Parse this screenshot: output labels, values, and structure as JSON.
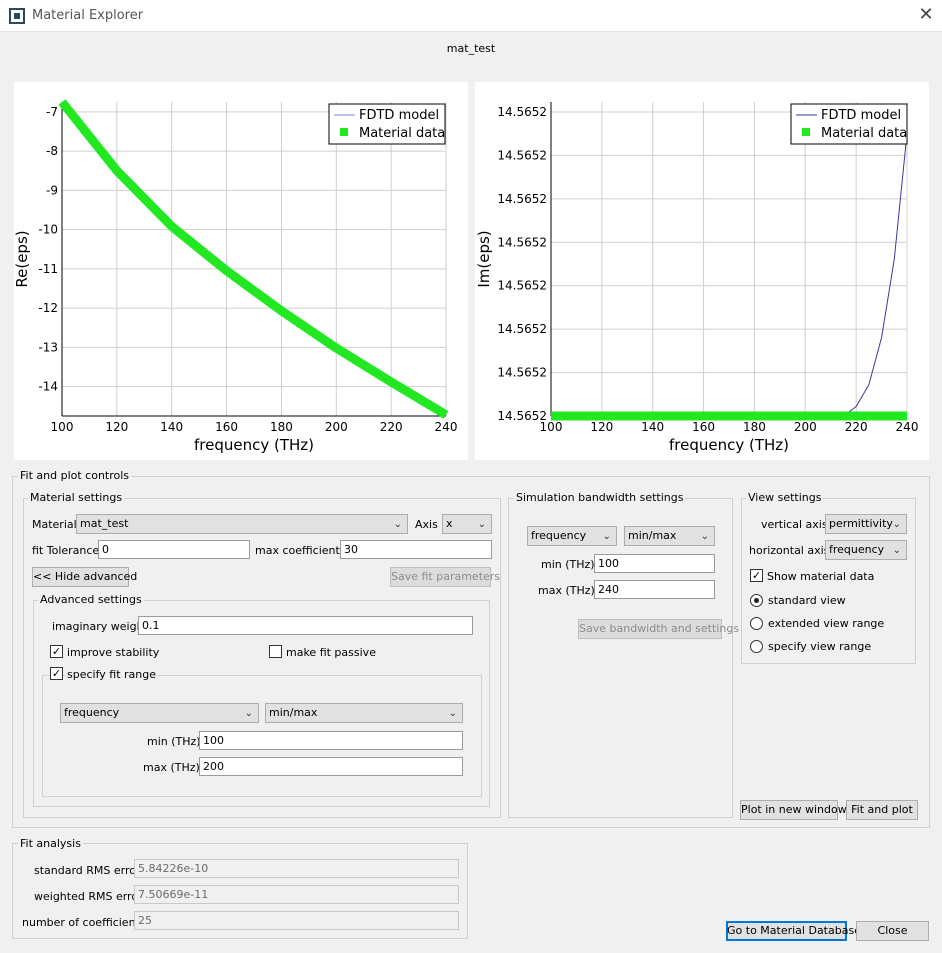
{
  "window": {
    "title": "Material Explorer",
    "close_glyph": "✕",
    "material_title": "mat_test"
  },
  "plots": {
    "legend": {
      "model": "FDTD model",
      "data": "Material data"
    },
    "left": {
      "ylabel": "Re(eps)",
      "xlabel": "frequency (THz)",
      "xticks": [
        "100",
        "120",
        "140",
        "160",
        "180",
        "200",
        "220",
        "240"
      ],
      "yticks": [
        "-7",
        "-8",
        "-9",
        "-10",
        "-11",
        "-12",
        "-13",
        "-14"
      ]
    },
    "right": {
      "ylabel": "Im(eps)",
      "xlabel": "frequency (THz)",
      "xticks": [
        "100",
        "120",
        "140",
        "160",
        "180",
        "200",
        "220",
        "240"
      ],
      "yticks": [
        "14.5652",
        "14.5652",
        "14.5652",
        "14.5652",
        "14.5652",
        "14.5652",
        "14.5652",
        "14.5652"
      ]
    }
  },
  "chart_data": [
    {
      "type": "line",
      "xlabel": "frequency (THz)",
      "ylabel": "Re(eps)",
      "xlim": [
        100,
        240
      ],
      "ylim": [
        -14.75,
        -6.75
      ],
      "series": [
        {
          "name": "FDTD model",
          "color": "#7b86d6",
          "x": [
            100,
            120,
            140,
            160,
            180,
            200,
            220,
            240
          ],
          "y": [
            -6.75,
            -8.5,
            -9.92,
            -11.05,
            -12.07,
            -13.02,
            -13.88,
            -14.72
          ]
        },
        {
          "name": "Material data",
          "color": "#22e822",
          "x": [
            100,
            120,
            140,
            160,
            180,
            200,
            220,
            240
          ],
          "y": [
            -6.75,
            -8.5,
            -9.92,
            -11.05,
            -12.07,
            -13.02,
            -13.88,
            -14.72
          ]
        }
      ]
    },
    {
      "type": "line",
      "xlabel": "frequency (THz)",
      "ylabel": "Im(eps)",
      "xlim": [
        100,
        240
      ],
      "ylim": [
        0,
        1
      ],
      "series": [
        {
          "name": "FDTD model",
          "color": "#3a3aa0",
          "x": [
            100,
            200,
            215,
            220,
            225,
            230,
            235,
            240
          ],
          "y": [
            0,
            0,
            0,
            0.03,
            0.1,
            0.25,
            0.5,
            0.9
          ]
        },
        {
          "name": "Material data",
          "color": "#22e822",
          "x": [
            100,
            120,
            140,
            160,
            180,
            200,
            220,
            240
          ],
          "y": [
            0,
            0,
            0,
            0,
            0,
            0,
            0,
            0
          ]
        }
      ]
    }
  ],
  "fit_controls": {
    "title": "Fit and plot controls",
    "material_settings": {
      "title": "Material settings",
      "material_label": "Material",
      "material_value": "mat_test",
      "axis_label": "Axis",
      "axis_value": "x",
      "fit_tolerance_label": "fit Tolerance",
      "fit_tolerance_value": "0",
      "max_coeff_label": "max coefficients",
      "max_coeff_value": "30",
      "hide_advanced": "<< Hide advanced",
      "save_fit": "Save fit parameters"
    },
    "advanced": {
      "title": "Advanced settings",
      "imag_weight_label": "imaginary weight",
      "imag_weight_value": "0.1",
      "improve_stability": "improve stability",
      "make_passive": "make fit passive",
      "specify_range": "specify fit range",
      "range_type": "frequency",
      "range_mode": "min/max",
      "min_label": "min (THz)",
      "min_value": "100",
      "max_label": "max (THz)",
      "max_value": "200",
      "check_glyph": "✓"
    },
    "simulation": {
      "title": "Simulation bandwidth settings",
      "type": "frequency",
      "mode": "min/max",
      "min_label": "min (THz)",
      "min_value": "100",
      "max_label": "max (THz)",
      "max_value": "240",
      "save": "Save bandwidth and settings"
    },
    "view": {
      "title": "View settings",
      "vaxis_label": "vertical axis",
      "vaxis_value": "permittivity",
      "haxis_label": "horizontal axis",
      "haxis_value": "frequency",
      "show_data": "Show material data",
      "standard": "standard view",
      "extended": "extended view range",
      "specify": "specify view range"
    },
    "plot_new": "Plot in new window",
    "fit_plot": "Fit and plot"
  },
  "fit_analysis": {
    "title": "Fit analysis",
    "std_label": "standard RMS error",
    "std_value": "5.84226e-10",
    "weighted_label": "weighted RMS error",
    "weighted_value": "7.50669e-11",
    "ncoeff_label": "number of coefficients",
    "ncoeff_value": "25"
  },
  "footer": {
    "goto_db": "Go to Material Database",
    "close": "Close"
  },
  "glyphs": {
    "dropdown": "⌄"
  }
}
